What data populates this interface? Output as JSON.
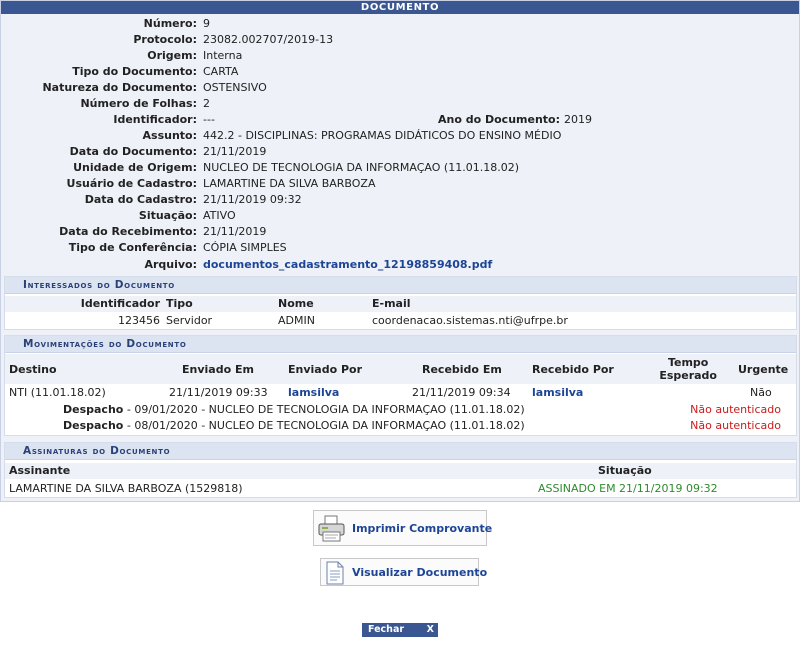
{
  "title": "Documento",
  "fields": {
    "numero": {
      "label": "Número:",
      "value": "9"
    },
    "protocolo": {
      "label": "Protocolo:",
      "value": "23082.002707/2019-13"
    },
    "origem": {
      "label": "Origem:",
      "value": "Interna"
    },
    "tipo": {
      "label": "Tipo do Documento:",
      "value": "CARTA"
    },
    "natureza": {
      "label": "Natureza do Documento:",
      "value": "OSTENSIVO"
    },
    "folhas": {
      "label": "Número de Folhas:",
      "value": "2"
    },
    "identificador": {
      "label": "Identificador:",
      "value": "---"
    },
    "ano": {
      "label": "Ano do Documento:",
      "value": "2019"
    },
    "assunto": {
      "label": "Assunto:",
      "value": "442.2 - DISCIPLINAS: PROGRAMAS DIDÁTICOS DO ENSINO MÉDIO"
    },
    "data_documento": {
      "label": "Data do Documento:",
      "value": "21/11/2019"
    },
    "unidade_origem": {
      "label": "Unidade de Origem:",
      "value": "NUCLEO DE TECNOLOGIA DA INFORMAÇAO (11.01.18.02)"
    },
    "usuario_cadastro": {
      "label": "Usuário de Cadastro:",
      "value": "LAMARTINE DA SILVA BARBOZA"
    },
    "data_cadastro": {
      "label": "Data do Cadastro:",
      "value": "21/11/2019 09:32"
    },
    "situacao": {
      "label": "Situação:",
      "value": "ATIVO"
    },
    "data_recebimento": {
      "label": "Data do Recebimento:",
      "value": "21/11/2019"
    },
    "tipo_conferencia": {
      "label": "Tipo de Conferência:",
      "value": "CÓPIA SIMPLES"
    },
    "arquivo": {
      "label": "Arquivo:",
      "value": "documentos_cadastramento_12198859408.pdf"
    }
  },
  "interessados": {
    "title": "Interessados do Documento",
    "headers": {
      "identificador": "Identificador",
      "tipo": "Tipo",
      "nome": "Nome",
      "email": "E-mail"
    },
    "rows": [
      {
        "identificador": "123456",
        "tipo": "Servidor",
        "nome": "ADMIN",
        "email": "coordenacao.sistemas.nti@ufrpe.br"
      }
    ]
  },
  "movimentacoes": {
    "title": "Movimentações do Documento",
    "headers": {
      "destino": "Destino",
      "enviado_em": "Enviado Em",
      "enviado_por": "Enviado Por",
      "recebido_em": "Recebido Em",
      "recebido_por": "Recebido Por",
      "tempo_esperado_1": "Tempo",
      "tempo_esperado_2": "Esperado",
      "urgente": "Urgente"
    },
    "rows": [
      {
        "destino": "NTI (11.01.18.02)",
        "enviado_em": "21/11/2019 09:33",
        "enviado_por": "lamsilva",
        "recebido_em": "21/11/2019 09:34",
        "recebido_por": "lamsilva",
        "urgente": "Não"
      }
    ],
    "despachos": [
      {
        "label": "Despacho",
        "text": " - 09/01/2020 - NUCLEO DE TECNOLOGIA DA INFORMAÇAO (11.01.18.02)",
        "status": "Não autenticado"
      },
      {
        "label": "Despacho",
        "text": " - 08/01/2020 - NUCLEO DE TECNOLOGIA DA INFORMAÇAO (11.01.18.02)",
        "status": "Não autenticado"
      }
    ]
  },
  "assinaturas": {
    "title": "Assinaturas do Documento",
    "headers": {
      "assinante": "Assinante",
      "situacao": "Situação"
    },
    "rows": [
      {
        "assinante": "LAMARTINE DA SILVA BARBOZA (1529818)",
        "situacao": "ASSINADO EM 21/11/2019 09:32"
      }
    ]
  },
  "buttons": {
    "imprimir": "Imprimir Comprovante",
    "visualizar": "Visualizar Documento",
    "fechar": "Fechar",
    "fechar_x": "X"
  },
  "icons": {
    "imprimir": "printer-icon",
    "visualizar": "document-icon"
  },
  "colors": {
    "caption": "#3b5791",
    "link": "#1d4596",
    "status_red": "#cc1a1a",
    "status_green": "#2e8b2e"
  }
}
